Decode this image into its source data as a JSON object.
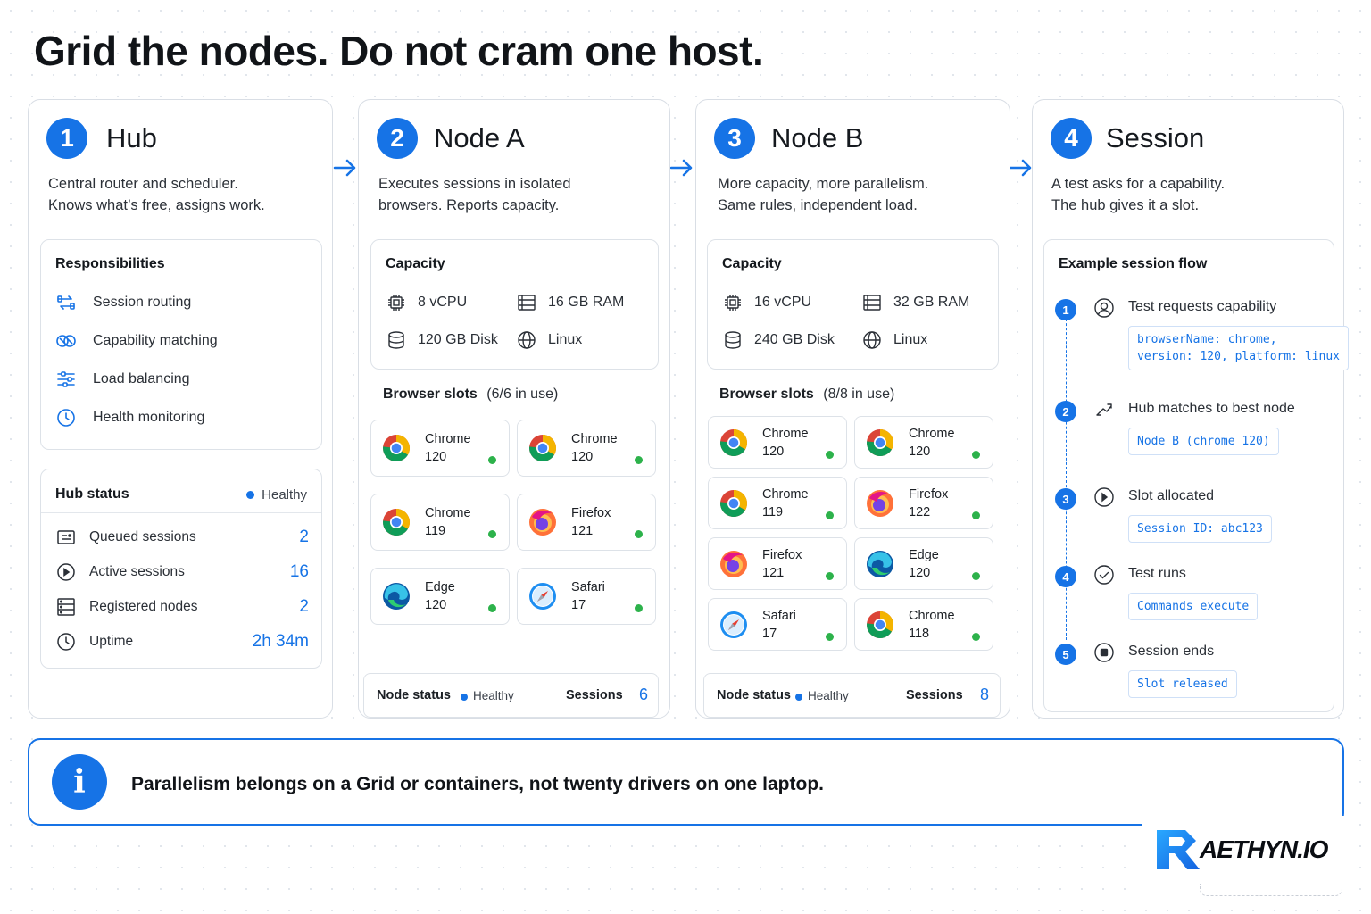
{
  "title": "Grid the nodes. Do not cram one host.",
  "colors": {
    "accent": "#1673e6",
    "healthy_dot": "#2db24b",
    "text": "#1b1f24",
    "border": "#dde2e8"
  },
  "hub": {
    "number": "1",
    "title": "Hub",
    "desc": [
      "Central router and scheduler.",
      "Knows what’s free, assigns work."
    ],
    "responsibilities": {
      "title": "Responsibilities",
      "items": [
        {
          "label": "Session routing",
          "icon": "routing-icon"
        },
        {
          "label": "Capability matching",
          "icon": "capability-icon"
        },
        {
          "label": "Load balancing",
          "icon": "sliders-icon"
        },
        {
          "label": "Health monitoring",
          "icon": "clock-icon"
        }
      ]
    },
    "status": {
      "title": "Hub status",
      "health": "Healthy",
      "rows": [
        {
          "label": "Queued sessions",
          "value": "2",
          "icon": "queue-icon"
        },
        {
          "label": "Active sessions",
          "value": "16",
          "icon": "play-icon"
        },
        {
          "label": "Registered nodes",
          "value": "2",
          "icon": "server-icon"
        },
        {
          "label": "Uptime",
          "value": "2h 34m",
          "icon": "clock-icon"
        }
      ]
    }
  },
  "nodeA": {
    "number": "2",
    "title": "Node A",
    "desc": [
      "Executes sessions in isolated",
      "browsers. Reports capacity."
    ],
    "capacity": {
      "title": "Capacity",
      "items": [
        {
          "label": "8 vCPU",
          "icon": "cpu-icon"
        },
        {
          "label": "16 GB RAM",
          "icon": "ram-icon"
        },
        {
          "label": "120 GB Disk",
          "icon": "disk-icon"
        },
        {
          "label": "Linux",
          "icon": "globe-icon"
        }
      ]
    },
    "slots_title": "Browser slots",
    "slots_usage": "(6/6 in use)",
    "slots": [
      {
        "browser": "chrome",
        "name": "Chrome",
        "version": "120"
      },
      {
        "browser": "chrome",
        "name": "Chrome",
        "version": "120"
      },
      {
        "browser": "chrome",
        "name": "Chrome",
        "version": "119"
      },
      {
        "browser": "firefox",
        "name": "Firefox",
        "version": "121"
      },
      {
        "browser": "edge",
        "name": "Edge",
        "version": "120"
      },
      {
        "browser": "safari",
        "name": "Safari",
        "version": "17"
      }
    ],
    "status": {
      "label": "Node status",
      "health": "Healthy",
      "sessions_label": "Sessions",
      "sessions_value": "6"
    }
  },
  "nodeB": {
    "number": "3",
    "title": "Node B",
    "desc": [
      "More capacity, more parallelism.",
      "Same rules, independent load."
    ],
    "capacity": {
      "title": "Capacity",
      "items": [
        {
          "label": "16 vCPU",
          "icon": "cpu-icon"
        },
        {
          "label": "32 GB RAM",
          "icon": "ram-icon"
        },
        {
          "label": "240 GB Disk",
          "icon": "disk-icon"
        },
        {
          "label": "Linux",
          "icon": "globe-icon"
        }
      ]
    },
    "slots_title": "Browser slots",
    "slots_usage": "(8/8 in use)",
    "slots": [
      {
        "browser": "chrome",
        "name": "Chrome",
        "version": "120"
      },
      {
        "browser": "chrome",
        "name": "Chrome",
        "version": "120"
      },
      {
        "browser": "chrome",
        "name": "Chrome",
        "version": "119"
      },
      {
        "browser": "firefox",
        "name": "Firefox",
        "version": "122"
      },
      {
        "browser": "firefox",
        "name": "Firefox",
        "version": "121"
      },
      {
        "browser": "edge",
        "name": "Edge",
        "version": "120"
      },
      {
        "browser": "safari",
        "name": "Safari",
        "version": "17"
      },
      {
        "browser": "chrome",
        "name": "Chrome",
        "version": "118"
      }
    ],
    "status": {
      "label": "Node status",
      "health": "Healthy",
      "sessions_label": "Sessions",
      "sessions_value": "8"
    }
  },
  "session": {
    "number": "4",
    "title": "Session",
    "desc": [
      "A test asks for a capability.",
      "The hub gives it a slot."
    ],
    "flow_title": "Example session flow",
    "steps": [
      {
        "n": "1",
        "label": "Test requests capability",
        "icon": "user-icon",
        "code": "browserName: chrome,\nversion: 120, platform: linux"
      },
      {
        "n": "2",
        "label": "Hub matches to best node",
        "icon": "share-icon",
        "code": "Node B (chrome 120)"
      },
      {
        "n": "3",
        "label": "Slot allocated",
        "icon": "play-icon",
        "code": "Session ID: abc123"
      },
      {
        "n": "4",
        "label": "Test runs",
        "icon": "check-icon",
        "code": "Commands execute"
      },
      {
        "n": "5",
        "label": "Session ends",
        "icon": "stop-icon",
        "code": "Slot released"
      }
    ]
  },
  "info": {
    "icon": "info-icon",
    "letter": "i",
    "text": "Parallelism belongs on a Grid or containers, not twenty drivers on one laptop."
  },
  "brand": {
    "name": "AETHYN.IO"
  }
}
